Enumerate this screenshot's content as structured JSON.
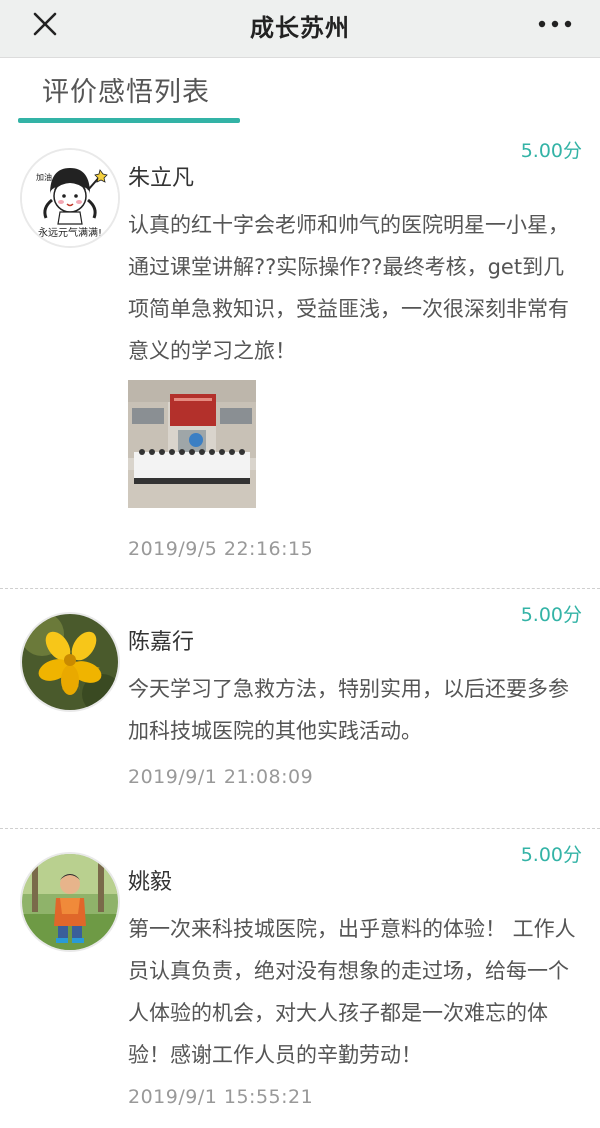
{
  "nav": {
    "title": "成长苏州",
    "close_icon": "close-icon",
    "more_icon": "more-icon"
  },
  "tab": {
    "label": "评价感悟列表",
    "accent_color": "#33b3a6"
  },
  "reviews": [
    {
      "score": "5.00分",
      "name": "朱立凡",
      "content": "认真的红十字会老师和帅气的医院明星一小星，通过课堂讲解??实际操作??最终考核，get到几项简单急救知识，受益匪浅，一次很深刻非常有意义的学习之旅！",
      "time": "2019/9/5 22:16:15",
      "avatar_caption": "永远元气满满!",
      "avatar_tag": "加油"
    },
    {
      "score": "5.00分",
      "name": "陈嘉行",
      "content": "今天学习了急救方法，特别实用，以后还要多参加科技城医院的其他实践活动。",
      "time": "2019/9/1 21:08:09"
    },
    {
      "score": "5.00分",
      "name": "姚毅",
      "content": "第一次来科技城医院，出乎意料的体验！ 工作人员认真负责，绝对没有想象的走过场，给每一个人体验的机会，对大人孩子都是一次难忘的体验！感谢工作人员的辛勤劳动！",
      "time": "2019/9/1 15:55:21"
    }
  ]
}
